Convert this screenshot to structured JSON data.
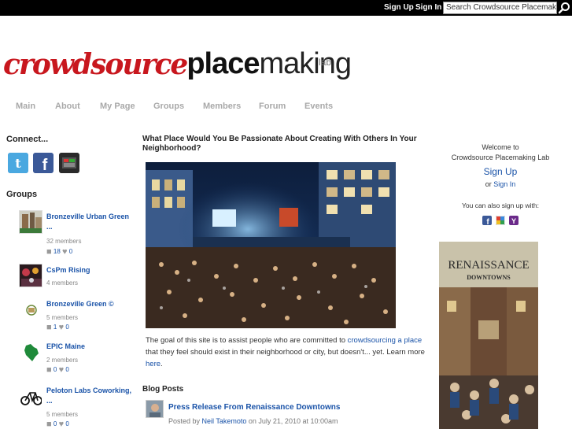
{
  "topbar": {
    "sign_up": "Sign Up",
    "sign_in": "Sign In",
    "search_value": "Search Crowdsource Placemaking",
    "search_icon": "magnifier-icon"
  },
  "logo": {
    "part1": "crowdsource",
    "part2": "place",
    "part3": "making",
    "part4": "lab"
  },
  "nav": {
    "items": [
      "Main",
      "About",
      "My Page",
      "Groups",
      "Members",
      "Forum",
      "Events"
    ]
  },
  "left": {
    "connect_title": "Connect...",
    "social_icons": [
      "twitter-icon",
      "facebook-icon",
      "video-icon"
    ],
    "groups_title": "Groups",
    "groups": [
      {
        "name": "Bronzeville Urban Green ...",
        "members": "32 members",
        "comments": "18",
        "likes": "0"
      },
      {
        "name": "CsPm Rising",
        "members": "4 members",
        "comments": "",
        "likes": ""
      },
      {
        "name": "Bronzeville Green ©",
        "members": "5 members",
        "comments": "1",
        "likes": "0"
      },
      {
        "name": "EPIC Maine",
        "members": "2 members",
        "comments": "0",
        "likes": "0"
      },
      {
        "name": "Peloton Labs Coworking, ...",
        "members": "5 members",
        "comments": "0",
        "likes": "0"
      }
    ]
  },
  "main": {
    "question_title": "What Place Would You Be Passionate About Creating With Others In Your Neighborhood?",
    "desc_part1": "The goal of this site is to assist people who are committed to ",
    "desc_link1": "crowdsourcing a place",
    "desc_part2": " that they feel should exist in their neighborhood or city, but doesn't... yet. Learn more ",
    "desc_link2": "here",
    "desc_part3": ".",
    "blog_title": "Blog Posts",
    "post": {
      "title": "Press Release From Renaissance Downtowns",
      "posted_by": "Posted by ",
      "author": "Neil Takemoto",
      "date_text": " on July 21, 2010 at 10:00am"
    }
  },
  "right": {
    "welcome": "Welcome to",
    "site_name": "Crowdsource Placemaking Lab",
    "sign_up": "Sign Up",
    "or": "or ",
    "sign_in": "Sign In",
    "also": "You can also sign up with:",
    "signup_icons": [
      "facebook-icon",
      "google-icon",
      "yahoo-icon"
    ],
    "ad_title_1": "RENAISSANCE",
    "ad_title_2": "DOWNTOWNS"
  },
  "colors": {
    "brand_red": "#c8171e",
    "link_blue": "#1a53a8",
    "nav_gray": "#a9a9a9",
    "topbar_black": "#000000"
  }
}
